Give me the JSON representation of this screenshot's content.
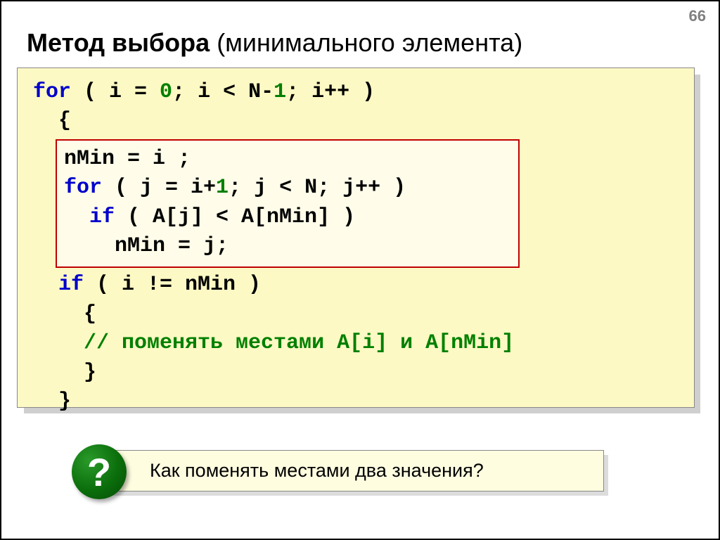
{
  "page_number": "66",
  "title": {
    "bold": "Метод выбора",
    "rest": " (минимального элемента)"
  },
  "code": {
    "l1_for": "for",
    "l1a": " ( i = ",
    "l1_zero": "0",
    "l1b": "; i < N-",
    "l1_one": "1",
    "l1c": "; i++ )",
    "l2": "  {",
    "inner_l1": "nMin = i ;",
    "inner_l2_for": "for",
    "inner_l2a": " ( j = i+",
    "inner_l2_one": "1",
    "inner_l2b": "; j < N; j++ )",
    "inner_l3_if": "  if",
    "inner_l3a": " ( A[j] < A[nMin] )",
    "inner_l4": "    nMin = j;",
    "l3_if": "  if",
    "l3a": " ( i != nMin )",
    "l4": "    {",
    "l5_cmt": "    // поменять местами A[i] и A[nMin]",
    "l6": "    }",
    "l7": "  }"
  },
  "callout": {
    "icon": "?",
    "text": "Как поменять местами два значения?"
  }
}
